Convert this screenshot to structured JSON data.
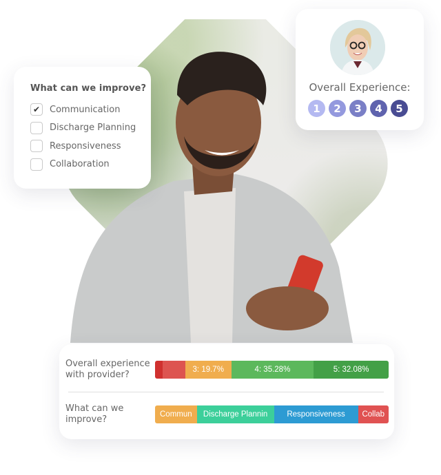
{
  "improve_card": {
    "title": "What can we improve?",
    "options": [
      {
        "label": "Communication",
        "checked": true
      },
      {
        "label": "Discharge Planning",
        "checked": false
      },
      {
        "label": "Responsiveness",
        "checked": false
      },
      {
        "label": "Collaboration",
        "checked": false
      }
    ],
    "check_glyph": "✔"
  },
  "experience_card": {
    "label": "Overall Experience:",
    "ratings": [
      {
        "value": "1",
        "color": "#b4b9f1"
      },
      {
        "value": "2",
        "color": "#9499de"
      },
      {
        "value": "3",
        "color": "#7a7fc6"
      },
      {
        "value": "4",
        "color": "#5f63ae"
      },
      {
        "value": "5",
        "color": "#494c93"
      }
    ]
  },
  "results_card": {
    "rows": [
      {
        "question": "Overall experience with provider?",
        "segments": [
          {
            "label": "",
            "percent": 3.29,
            "color": "#d0312f"
          },
          {
            "label": "",
            "percent": 9.65,
            "color": "#dd5450"
          },
          {
            "label": "3: 19.7%",
            "percent": 19.7,
            "color": "#f0ad4e"
          },
          {
            "label": "4: 35.28%",
            "percent": 35.28,
            "color": "#5cb85c"
          },
          {
            "label": "5: 32.08%",
            "percent": 32.08,
            "color": "#43a047"
          }
        ]
      },
      {
        "question": "What can we improve?",
        "segments": [
          {
            "label": "Commun",
            "percent": 17.9,
            "color": "#f0ad4e"
          },
          {
            "label": "Discharge Plannin",
            "percent": 33.0,
            "color": "#3ccf9a"
          },
          {
            "label": "Responsiveness",
            "percent": 36.0,
            "color": "#2d9bd3"
          },
          {
            "label": "Collab",
            "percent": 13.1,
            "color": "#e05252"
          }
        ]
      }
    ]
  }
}
